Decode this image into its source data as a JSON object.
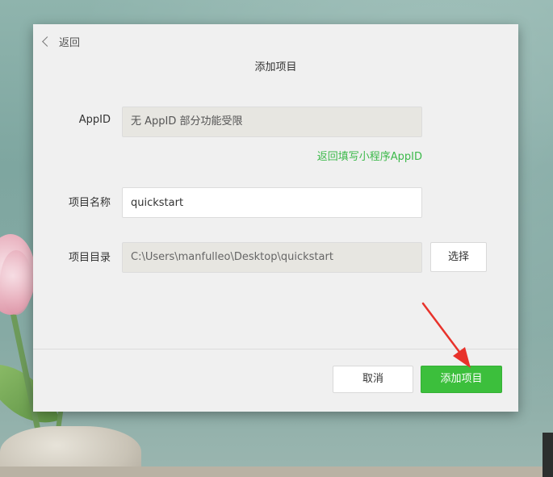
{
  "header": {
    "back_label": "返回",
    "title": "添加项目"
  },
  "form": {
    "appid": {
      "label": "AppID",
      "value": "无 AppID 部分功能受限"
    },
    "appid_link": "返回填写小程序AppID",
    "name": {
      "label": "项目名称",
      "value": "quickstart"
    },
    "dir": {
      "label": "项目目录",
      "value": "C:\\Users\\manfulleo\\Desktop\\quickstart",
      "choose_label": "选择"
    }
  },
  "footer": {
    "cancel_label": "取消",
    "add_label": "添加项目"
  },
  "colors": {
    "accent_green": "#3cbf3c",
    "link_green": "#3cb94a",
    "annotation_red": "#e8322b"
  },
  "annotation": {
    "type": "arrow",
    "target": "add-project-button"
  }
}
